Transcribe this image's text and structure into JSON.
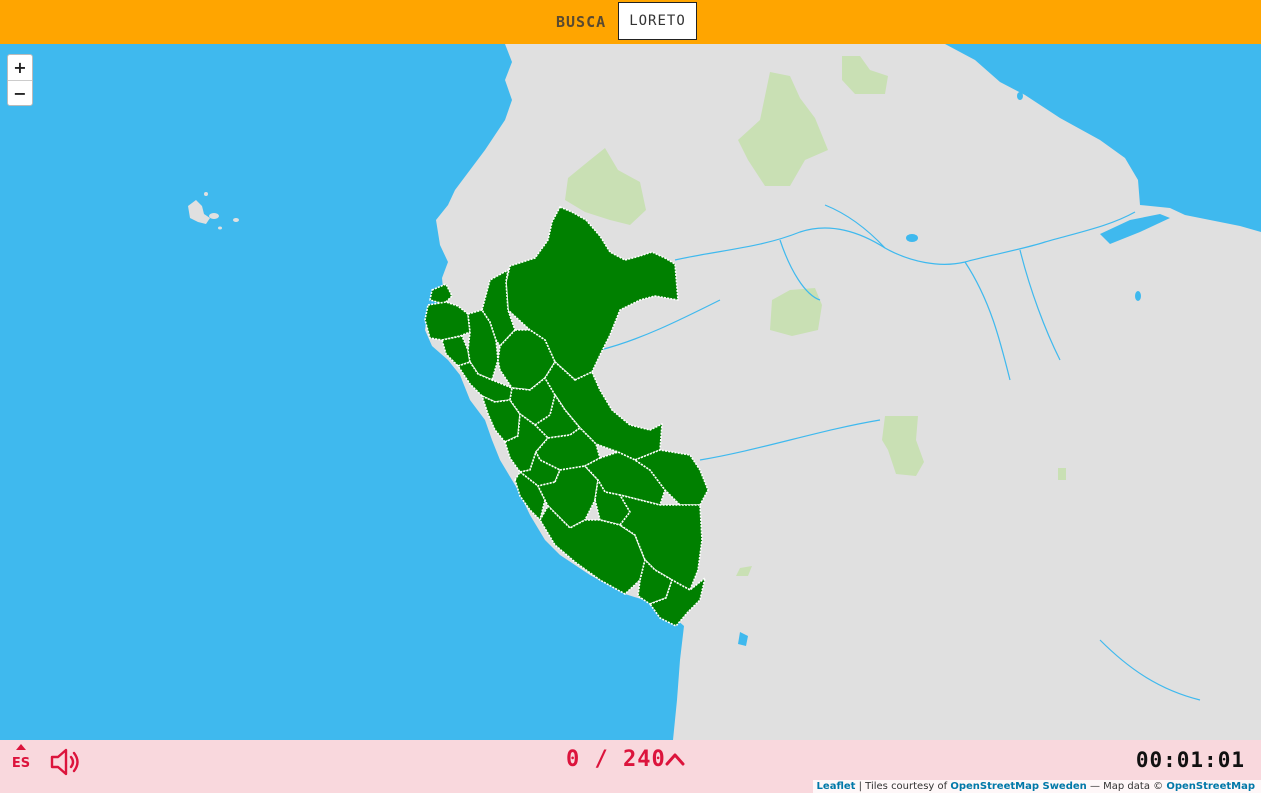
{
  "header": {
    "prompt_label": "BUSCA",
    "target_name": "LORETO"
  },
  "zoom": {
    "in_label": "+",
    "out_label": "−"
  },
  "footer": {
    "language": "ES",
    "score_found": "0",
    "score_separator": "/",
    "score_total": "240",
    "timer": "00:01:01",
    "attribution": {
      "leaflet": "Leaflet",
      "sep1": " | Tiles courtesy of ",
      "osm_sweden": "OpenStreetMap Sweden",
      "sep2": " — Map data © ",
      "osm": "OpenStreetMap"
    }
  },
  "icons": {
    "sound": "speaker-icon",
    "expand": "chevron-up-icon",
    "language_menu": "caret-up-icon"
  },
  "colors": {
    "ocean": "#3fb9ee",
    "land": "#e0e0e0",
    "region_fill": "#008000",
    "region_border": "#ffffff",
    "protected_area": "#c9e0b4",
    "header": "#ffa500",
    "footer": "#f9d8dd",
    "accent": "#dc143c"
  }
}
